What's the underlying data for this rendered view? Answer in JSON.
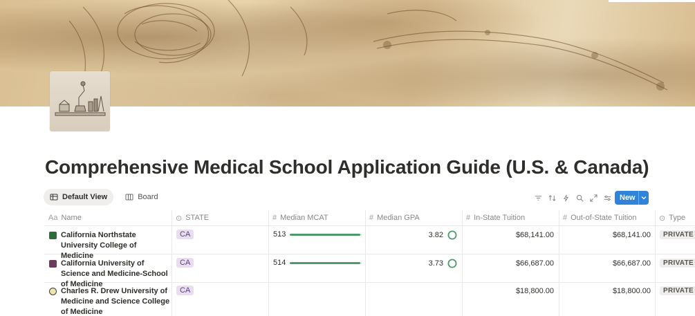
{
  "page": {
    "title": "Comprehensive Medical School Application Guide (U.S. & Canada)"
  },
  "views": {
    "default_label": "Default View",
    "board_label": "Board"
  },
  "toolbar": {
    "icons": [
      "filter-icon",
      "sort-icon",
      "automation-icon",
      "search-icon",
      "expand-icon",
      "settings-icon"
    ],
    "new_label": "New"
  },
  "columns": {
    "name": "Name",
    "state": "STATE",
    "mcat": "Median MCAT",
    "gpa": "Median GPA",
    "in_state": "In-State Tuition",
    "out_state": "Out-of-State Tuition",
    "type": "Type"
  },
  "rows": [
    {
      "name": "California Northstate University College of Medicine",
      "state": "CA",
      "mcat": "513",
      "mcat_progress": 0.98,
      "gpa": "3.82",
      "in_state": "$68,141.00",
      "out_state": "$68,141.00",
      "type": "PRIVATE"
    },
    {
      "name": "California University of Science and Medicine-School of Medicine",
      "state": "CA",
      "mcat": "514",
      "mcat_progress": 0.98,
      "gpa": "3.73",
      "in_state": "$66,687.00",
      "out_state": "$66,687.00",
      "type": "PRIVATE"
    },
    {
      "name": "Charles R. Drew University of Medicine and Science College of Medicine",
      "state": "CA",
      "mcat": "",
      "gpa": "",
      "in_state": "$18,800.00",
      "out_state": "$18,800.00",
      "type": "PRIVATE"
    }
  ],
  "colors": {
    "accent": "#2f83d9",
    "progress": "#4e9a6a",
    "state_tag_bg": "#e8def0"
  }
}
